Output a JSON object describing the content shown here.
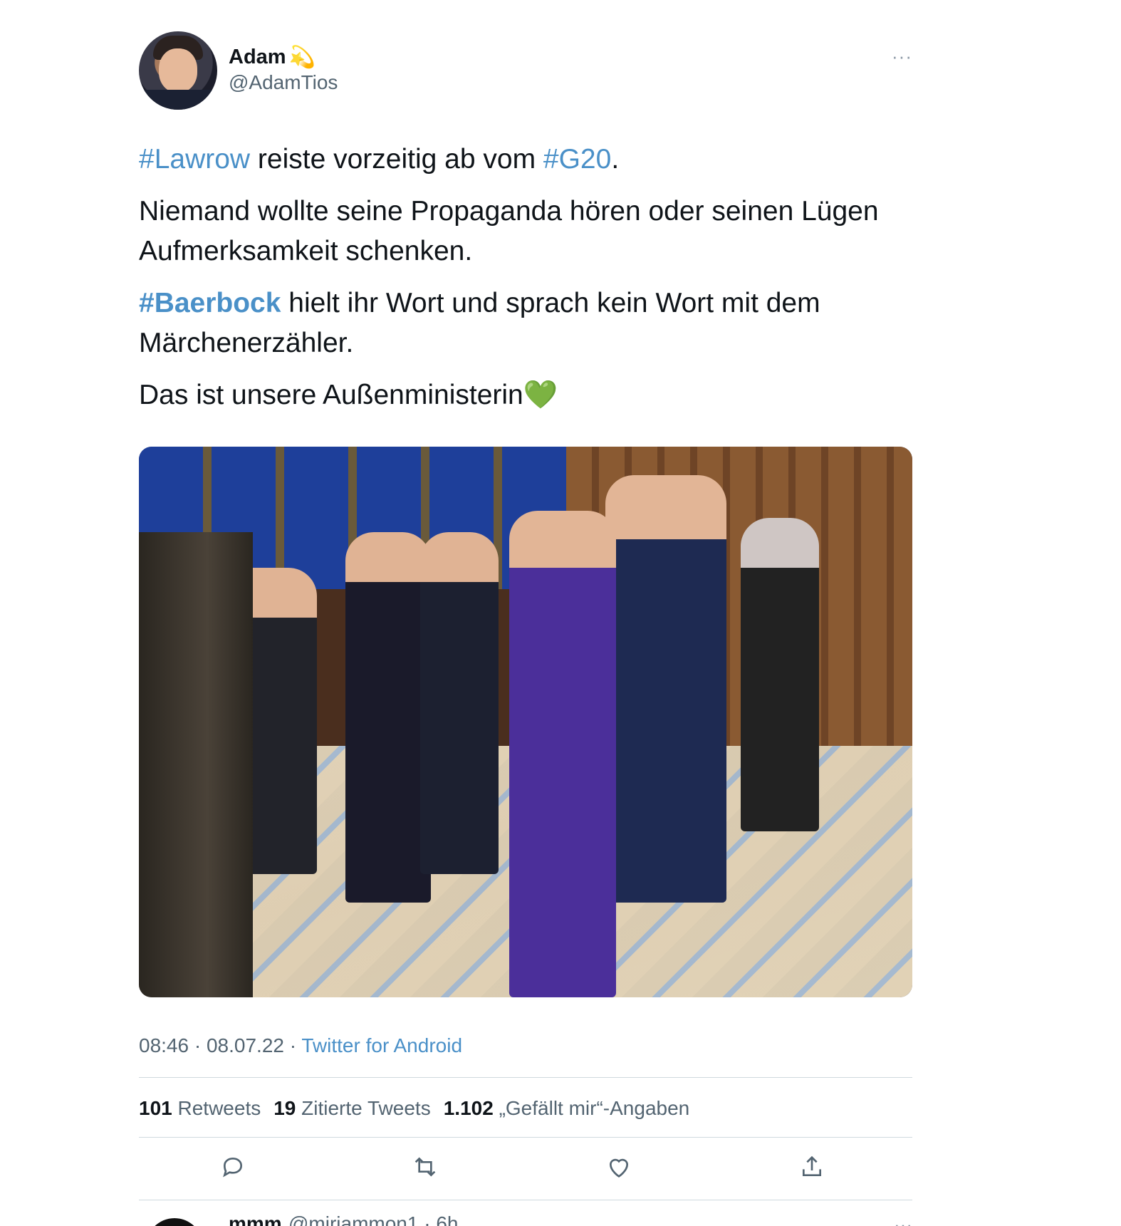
{
  "author": {
    "display_name": "Adam",
    "name_emoji": "💫",
    "handle": "@AdamTios"
  },
  "more_label": "···",
  "tweet": {
    "paragraph1": {
      "hashtag1": "#Lawrow",
      "text1": " reiste vorzeitig ab vom ",
      "hashtag2": "#G20",
      "text2": "."
    },
    "paragraph2": "Niemand wollte seine Propaganda hören oder seinen Lügen Aufmerksamkeit schenken.",
    "paragraph3": {
      "hashtag": "#Baerbock",
      "text": " hielt ihr Wort und sprach kein Wort mit dem Märchenerzähler."
    },
    "paragraph4": {
      "text": "Das ist unsere Außenministerin",
      "emoji": "💚"
    }
  },
  "meta": {
    "time": "08:46",
    "sep1": " · ",
    "date": "08.07.22",
    "sep2": " · ",
    "source": "Twitter for Android"
  },
  "stats": {
    "retweets_count": "101",
    "retweets_label": "Retweets",
    "quotes_count": "19",
    "quotes_label": "Zitierte Tweets",
    "likes_count": "1.102",
    "likes_label": "„Gefällt mir“-Angaben"
  },
  "next_reply": {
    "name": "mmm",
    "handle": "@miriammon1 · 6h",
    "more": "···"
  },
  "colors": {
    "hashtag": "#4a90c8",
    "secondary_text": "#536471",
    "divider": "#cfd9de"
  },
  "icons": [
    "reply-icon",
    "retweet-icon",
    "like-icon",
    "share-icon",
    "more-icon"
  ]
}
